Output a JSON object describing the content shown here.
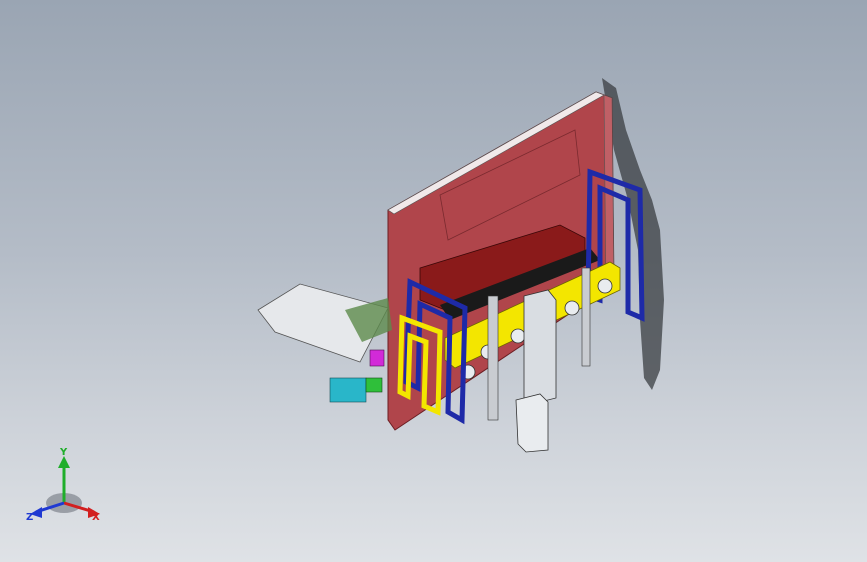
{
  "viewport": {
    "background_top": "#9aa5b3",
    "background_bottom": "#dfe2e6"
  },
  "model": {
    "colors": {
      "plate_red": "#b0454b",
      "frame_blue": "#1e2aa8",
      "bar_yellow": "#f3e600",
      "body_dark": "#8a1a1a",
      "cyan_part": "#29b6c9",
      "magenta_part": "#d22ad8",
      "green_part": "#2fbf3a",
      "rail_grey": "#c9ccd1",
      "shadow": "#3a3d42"
    }
  },
  "triad": {
    "y_label": "Y",
    "x_label": "X",
    "z_label": "Z",
    "colors": {
      "x": "#d21f1f",
      "y": "#1fae2a",
      "z": "#1f39d2"
    }
  }
}
